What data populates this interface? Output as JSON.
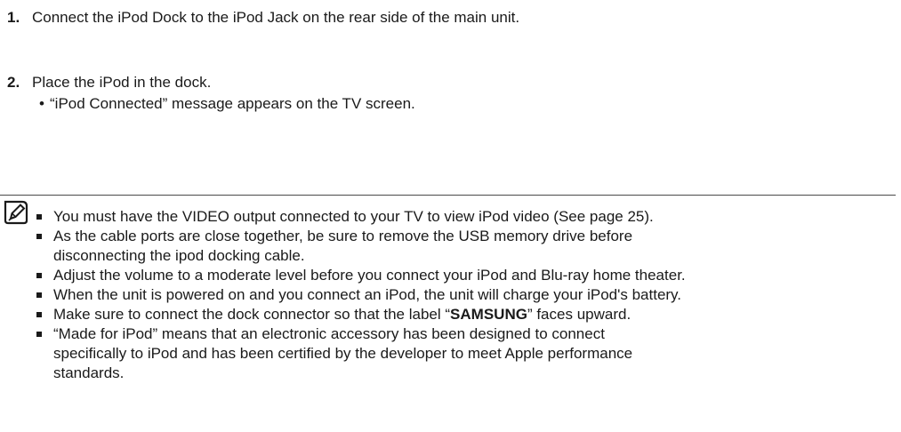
{
  "steps": [
    {
      "number": "1.",
      "text": "Connect the iPod Dock to the iPod Jack on the rear side of the main unit."
    },
    {
      "number": "2.",
      "text": "Place the iPod in the dock.",
      "sub_bullet": "“iPod Connected” message appears on the TV screen."
    }
  ],
  "note_icon": "note-pencil-icon",
  "notes": [
    {
      "lines": [
        "You must have the VIDEO output connected to your TV to view iPod video (See page 25)."
      ]
    },
    {
      "lines": [
        "As the cable ports are close together, be sure to remove the USB memory drive before",
        "disconnecting the ipod docking cable."
      ]
    },
    {
      "lines": [
        "Adjust the volume to a moderate level before you connect your iPod and Blu-ray home theater."
      ]
    },
    {
      "lines": [
        "When the unit is powered on and you connect an iPod, the unit will charge your iPod's battery."
      ]
    },
    {
      "pre": "Make sure to connect the dock connector so that the label “",
      "strong": "SAMSUNG",
      "post": "” faces upward."
    },
    {
      "lines": [
        "“Made for iPod” means that an electronic accessory has been designed to connect",
        "specifically to iPod and has been certified by the developer to meet Apple performance",
        "standards."
      ]
    }
  ]
}
